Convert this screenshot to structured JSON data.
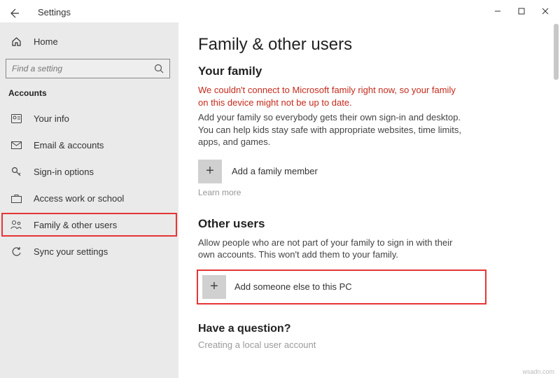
{
  "window": {
    "title": "Settings"
  },
  "sidebar": {
    "home_label": "Home",
    "search_placeholder": "Find a setting",
    "section": "Accounts",
    "items": [
      {
        "label": "Your info"
      },
      {
        "label": "Email & accounts"
      },
      {
        "label": "Sign-in options"
      },
      {
        "label": "Access work or school"
      },
      {
        "label": "Family & other users"
      },
      {
        "label": "Sync your settings"
      }
    ]
  },
  "main": {
    "title": "Family & other users",
    "family": {
      "heading": "Your family",
      "error": "We couldn't connect to Microsoft family right now, so your family on this device might not be up to date.",
      "desc": "Add your family so everybody gets their own sign-in and desktop. You can help kids stay safe with appropriate websites, time limits, apps, and games.",
      "add_label": "Add a family member",
      "learn_more": "Learn more"
    },
    "other": {
      "heading": "Other users",
      "desc": "Allow people who are not part of your family to sign in with their own accounts. This won't add them to your family.",
      "add_label": "Add someone else to this PC"
    },
    "question": {
      "heading": "Have a question?",
      "link": "Creating a local user account"
    }
  },
  "watermark": "wsadn.com"
}
